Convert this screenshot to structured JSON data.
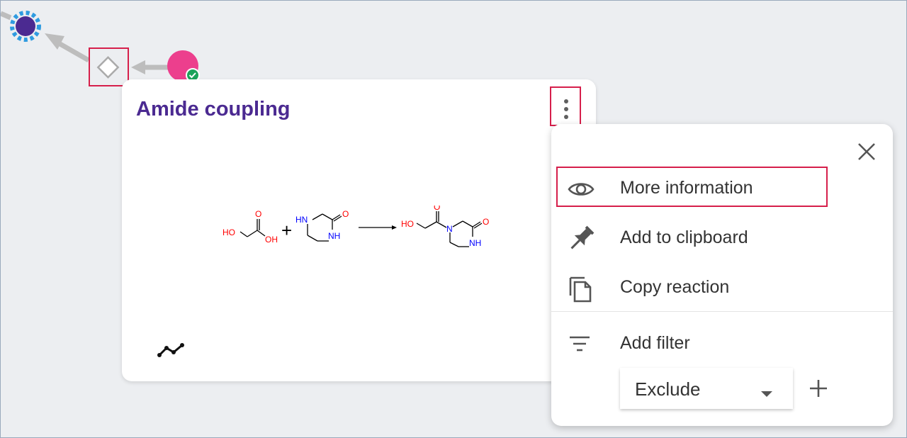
{
  "card": {
    "title": "Amide coupling",
    "reaction": {
      "reactant1_labels": {
        "ho": "HO",
        "o": "O",
        "oh": "OH"
      },
      "plus": "+",
      "reactant2_labels": {
        "hn": "HN",
        "o": "O",
        "nh": "NH"
      },
      "product_labels": {
        "ho": "HO",
        "o1": "O",
        "n": "N",
        "o2": "O",
        "nh": "NH"
      }
    }
  },
  "menu": {
    "items": [
      {
        "label": "More information",
        "icon": "eye-icon"
      },
      {
        "label": "Add to clipboard",
        "icon": "pin-icon"
      },
      {
        "label": "Copy reaction",
        "icon": "copy-icon"
      },
      {
        "label": "Add filter",
        "icon": "filter-icon"
      }
    ],
    "filter_select": {
      "value": "Exclude"
    }
  },
  "colors": {
    "title": "#4b2a91",
    "highlight": "#d61f4b",
    "target_node": "#4b2a91",
    "target_ring": "#2f9be0",
    "starting_material": "#ec3f8d",
    "available_badge": "#1aa35a",
    "heteroatom_oxygen": "#ff0000",
    "heteroatom_nitrogen": "#0000ff"
  }
}
